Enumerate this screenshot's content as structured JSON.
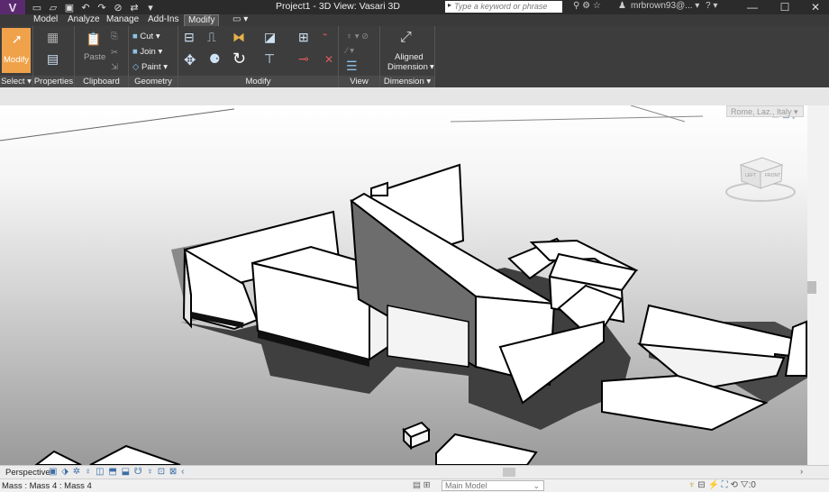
{
  "titlebar": {
    "app_logo": "V",
    "title": "Project1 - 3D View: Vasari 3D",
    "search_placeholder": "Type a keyword or phrase",
    "user": "mrbrown93@... ▾",
    "help": "? ▾"
  },
  "tabs": [
    {
      "label": "Model"
    },
    {
      "label": "Analyze"
    },
    {
      "label": "Manage"
    },
    {
      "label": "Add-Ins"
    },
    {
      "label": "Modify"
    },
    {
      "label": "▭ ▾"
    }
  ],
  "ribbon": {
    "modify_label": "Modify",
    "paste_label": "Paste",
    "cut_label": "Cut ▾",
    "join_label": "Join ▾",
    "paint_label": "Paint ▾",
    "aligned_label": "Aligned",
    "dimension_label": "Dimension",
    "dim_arrow": "▾",
    "panels": {
      "select": "Select ▾",
      "properties": "Properties",
      "clipboard": "Clipboard",
      "geometry": "Geometry",
      "modify": "Modify",
      "view": "View",
      "dimension": "Dimension ▾"
    }
  },
  "viewport": {
    "location_label": "Rome, Laz., Italy ▾",
    "cube_left": "LEFT",
    "cube_front": "FRONT"
  },
  "viewbar": {
    "view_label": "Perspective"
  },
  "statusbar": {
    "status_text": "Mass : Mass 4 : Mass 4",
    "model_select": "Main Model"
  },
  "colors": {
    "titlebar": "#2b2b2b",
    "ribbon": "#3d3d3d",
    "modify_active": "#f0a24a",
    "logo": "#5b2a6e"
  },
  "icons": [
    "app-logo-icon",
    "new-icon",
    "open-icon",
    "save-icon",
    "undo-icon",
    "redo-icon",
    "search-icon",
    "user-icon",
    "minimize-icon",
    "maximize-icon",
    "close-icon",
    "modify-cursor-icon",
    "paste-icon",
    "cut-icon",
    "join-icon",
    "paint-icon",
    "align-icon",
    "offset-icon",
    "mirror-icon",
    "move-icon",
    "copy-icon",
    "rotate-icon",
    "trim-icon",
    "delete-icon",
    "aligned-dimension-icon",
    "viewcube-icon",
    "main-model-icon"
  ]
}
